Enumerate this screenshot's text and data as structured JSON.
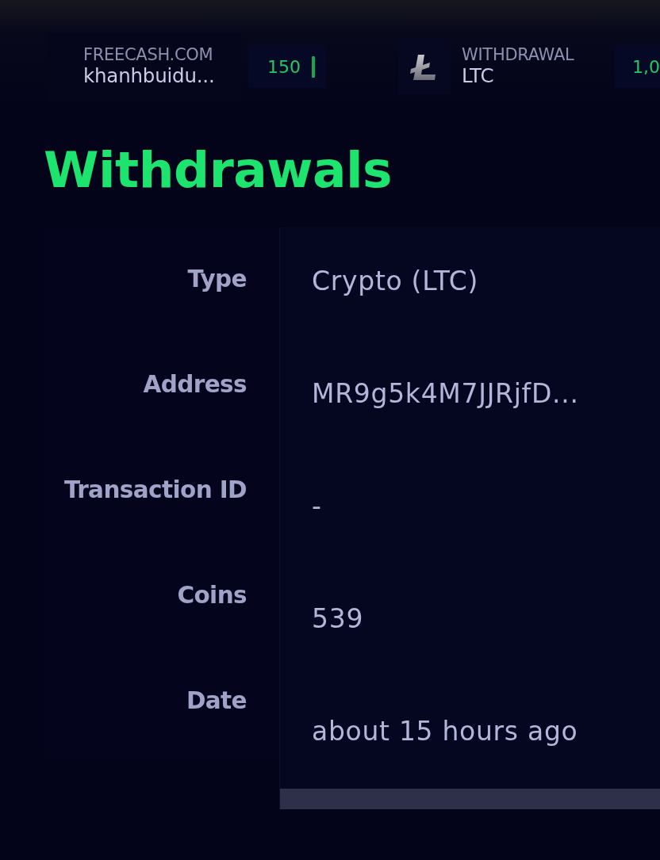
{
  "ticker": [
    {
      "kind": "user",
      "caption": "FREECASH.COM",
      "name": "khanhbuidu...",
      "amount": "150"
    },
    {
      "kind": "withdrawal",
      "caption": "WITHDRAWAL",
      "name": "LTC",
      "amount": "1,0"
    }
  ],
  "page": {
    "title": "Withdrawals"
  },
  "details": [
    {
      "label": "Type",
      "value": "Crypto (LTC)"
    },
    {
      "label": "Address",
      "value": "MR9g5k4M7JJRjfD..."
    },
    {
      "label": "Transaction ID",
      "value": "-"
    },
    {
      "label": "Coins",
      "value": "539"
    },
    {
      "label": "Date",
      "value": "about 15 hours ago"
    }
  ]
}
